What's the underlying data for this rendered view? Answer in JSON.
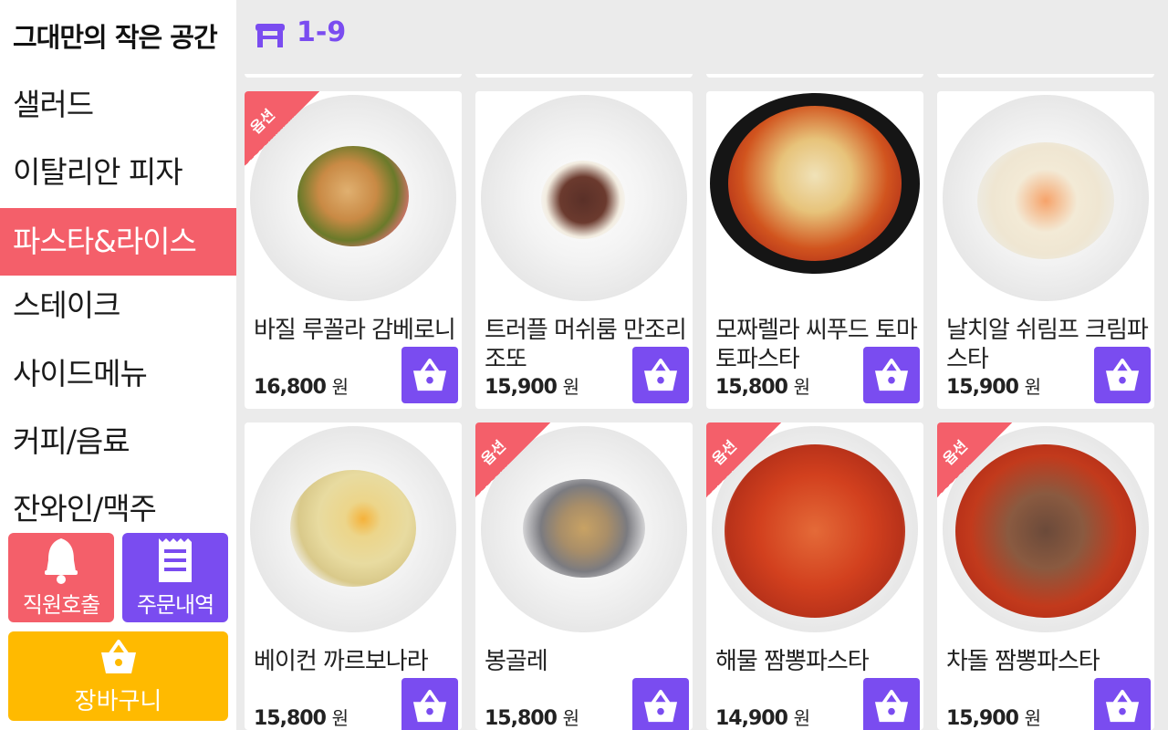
{
  "store": {
    "title": "그대만의 작은 공간"
  },
  "categories": [
    {
      "label": "샐러드",
      "active": false
    },
    {
      "label": "이탈리안 피자",
      "active": false
    },
    {
      "label": "파스타&라이스",
      "active": true
    },
    {
      "label": "스테이크",
      "active": false
    },
    {
      "label": "사이드메뉴",
      "active": false
    },
    {
      "label": "커피/음료",
      "active": false
    },
    {
      "label": "잔와인/맥주",
      "active": false
    }
  ],
  "actions": {
    "call_staff": "직원호출",
    "order_history": "주문내역",
    "cart": "장바구니"
  },
  "table": {
    "number": "1-9"
  },
  "currency": "원",
  "option_badge": "옵션",
  "menu_items": [
    {
      "name": "바질 루꼴라 감베로니",
      "price": "16,800",
      "option": true
    },
    {
      "name": "트러플 머쉬룸 만조리조또",
      "price": "15,900",
      "option": false
    },
    {
      "name": "모짜렐라 씨푸드 토마토파스타",
      "price": "15,800",
      "option": false
    },
    {
      "name": "날치알 쉬림프 크림파스타",
      "price": "15,900",
      "option": false
    },
    {
      "name": "베이컨 까르보나라",
      "price": "15,800",
      "option": false
    },
    {
      "name": "봉골레",
      "price": "15,800",
      "option": true
    },
    {
      "name": "해물 짬뽕파스타",
      "price": "14,900",
      "option": true
    },
    {
      "name": "차돌 짬뽕파스타",
      "price": "15,900",
      "option": true
    }
  ],
  "colors": {
    "accent": "#7a4cf0",
    "active_category": "#f45f6a",
    "cart": "#ffba00"
  }
}
